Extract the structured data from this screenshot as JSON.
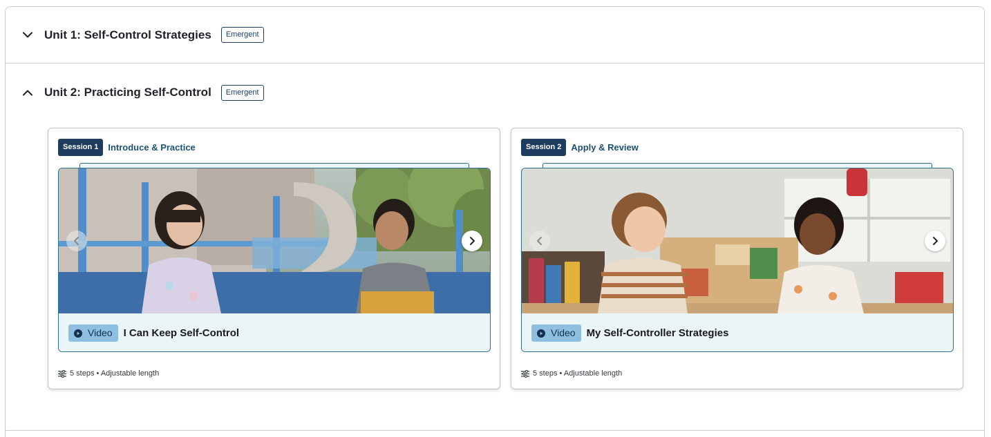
{
  "units": [
    {
      "title": "Unit 1: Self-Control Strategies",
      "badge": "Emergent",
      "expanded": false,
      "chevron_icon": "chevron-down-icon"
    },
    {
      "title": "Unit 2: Practicing Self-Control",
      "badge": "Emergent",
      "expanded": true,
      "chevron_icon": "chevron-up-icon"
    }
  ],
  "sessions": [
    {
      "pill": "Session 1",
      "label": "Introduce & Practice",
      "media_type": "Video",
      "media_title": "I Can Keep Self-Control",
      "meta": "5 steps • Adjustable length",
      "prev_icon": "chevron-left-icon",
      "next_icon": "chevron-right-icon",
      "thumbnail": "two children talking at a playground"
    },
    {
      "pill": "Session 2",
      "label": "Apply & Review",
      "media_type": "Video",
      "media_title": "My Self-Controller Strategies",
      "meta": "5 steps • Adjustable length",
      "prev_icon": "chevron-left-icon",
      "next_icon": "chevron-right-icon",
      "thumbnail": "two children smiling in a classroom"
    }
  ],
  "colors": {
    "navy": "#1d3c5e",
    "teal_border": "#2d6f8f",
    "light_panel": "#eaf5f8",
    "video_tag": "#8fbfe0"
  }
}
